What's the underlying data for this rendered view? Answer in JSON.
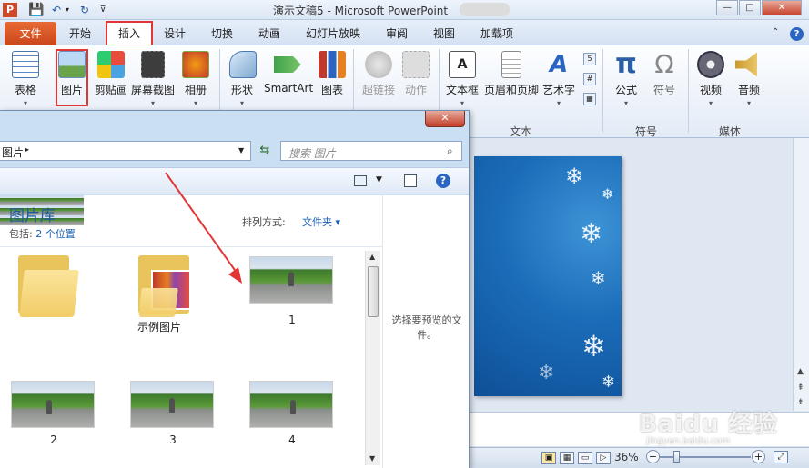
{
  "window": {
    "title": "演示文稿5 - Microsoft PowerPoint",
    "app_logo": "P",
    "controls": {
      "minimize": "—",
      "maximize": "□",
      "close": "✕"
    }
  },
  "qat": {
    "save": "💾",
    "undo": "↶",
    "redo": "↻",
    "drop": "▾",
    "customize": "⊽"
  },
  "tabs": {
    "file": "文件",
    "home": "开始",
    "insert": "插入",
    "design": "设计",
    "transitions": "切换",
    "animations": "动画",
    "slideshow": "幻灯片放映",
    "review": "审阅",
    "view": "视图",
    "addins": "加载项"
  },
  "ribbon": {
    "table": "表格",
    "picture": "图片",
    "clipart": "剪贴画",
    "screenshot": "屏幕截图",
    "album": "相册",
    "shapes": "形状",
    "smartart": "SmartArt",
    "chart": "图表",
    "hyperlink": "超链接",
    "action": "动作",
    "textbox": "文本框",
    "header_footer": "页眉和页脚",
    "wordart": "艺术字",
    "equation": "公式",
    "symbol": "符号",
    "video": "视频",
    "audio": "音频",
    "equation_glyph": "π",
    "symbol_glyph": "Ω",
    "group_text": "文本",
    "group_symbols": "符号",
    "group_media": "媒体",
    "dropdown": "▾"
  },
  "dialog": {
    "close": "✕",
    "address": "图片",
    "address_arrow": "▸",
    "search_placeholder": "搜索 图片",
    "library_title": "图片库",
    "includes_label": "包括:",
    "includes_link": "2 个位置",
    "sort_label": "排列方式:",
    "sort_value": "文件夹 ▾",
    "preview_text": "选择要预览的文件。",
    "help": "?",
    "items": [
      {
        "caption": ""
      },
      {
        "caption": "示例图片"
      },
      {
        "caption": "1"
      },
      {
        "caption": "2"
      },
      {
        "caption": "3"
      },
      {
        "caption": "4"
      }
    ]
  },
  "status": {
    "zoom": "36%",
    "zoom_minus": "−",
    "zoom_plus": "+"
  },
  "watermark": {
    "brand": "Baidu 经验",
    "url": "jingyan.baidu.com"
  },
  "colors": {
    "file_tab": "#d24726",
    "highlight": "#e23636",
    "library_title": "#1e5a9c",
    "slide_blue": "#1b6cb8"
  }
}
